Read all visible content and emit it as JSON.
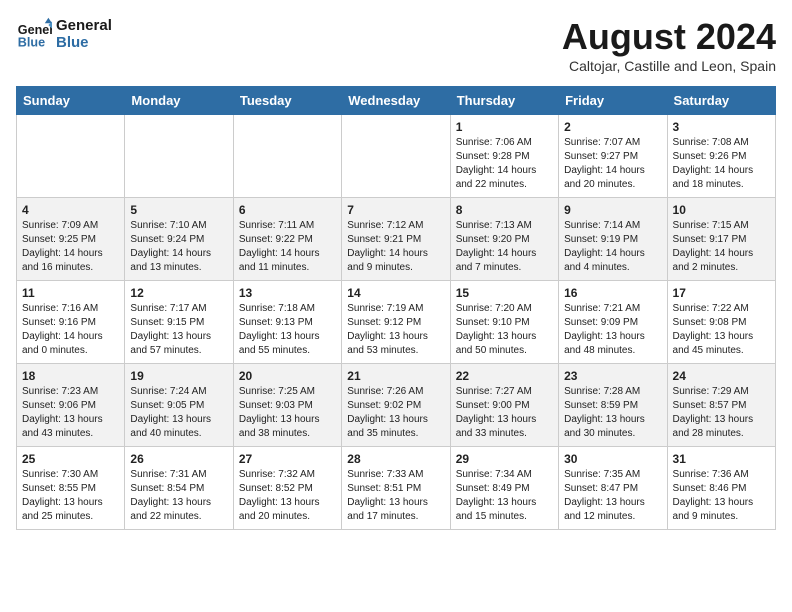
{
  "header": {
    "logo_line1": "General",
    "logo_line2": "Blue",
    "month_title": "August 2024",
    "subtitle": "Caltojar, Castille and Leon, Spain"
  },
  "days_of_week": [
    "Sunday",
    "Monday",
    "Tuesday",
    "Wednesday",
    "Thursday",
    "Friday",
    "Saturday"
  ],
  "weeks": [
    [
      {
        "day": "",
        "info": ""
      },
      {
        "day": "",
        "info": ""
      },
      {
        "day": "",
        "info": ""
      },
      {
        "day": "",
        "info": ""
      },
      {
        "day": "1",
        "info": "Sunrise: 7:06 AM\nSunset: 9:28 PM\nDaylight: 14 hours\nand 22 minutes."
      },
      {
        "day": "2",
        "info": "Sunrise: 7:07 AM\nSunset: 9:27 PM\nDaylight: 14 hours\nand 20 minutes."
      },
      {
        "day": "3",
        "info": "Sunrise: 7:08 AM\nSunset: 9:26 PM\nDaylight: 14 hours\nand 18 minutes."
      }
    ],
    [
      {
        "day": "4",
        "info": "Sunrise: 7:09 AM\nSunset: 9:25 PM\nDaylight: 14 hours\nand 16 minutes."
      },
      {
        "day": "5",
        "info": "Sunrise: 7:10 AM\nSunset: 9:24 PM\nDaylight: 14 hours\nand 13 minutes."
      },
      {
        "day": "6",
        "info": "Sunrise: 7:11 AM\nSunset: 9:22 PM\nDaylight: 14 hours\nand 11 minutes."
      },
      {
        "day": "7",
        "info": "Sunrise: 7:12 AM\nSunset: 9:21 PM\nDaylight: 14 hours\nand 9 minutes."
      },
      {
        "day": "8",
        "info": "Sunrise: 7:13 AM\nSunset: 9:20 PM\nDaylight: 14 hours\nand 7 minutes."
      },
      {
        "day": "9",
        "info": "Sunrise: 7:14 AM\nSunset: 9:19 PM\nDaylight: 14 hours\nand 4 minutes."
      },
      {
        "day": "10",
        "info": "Sunrise: 7:15 AM\nSunset: 9:17 PM\nDaylight: 14 hours\nand 2 minutes."
      }
    ],
    [
      {
        "day": "11",
        "info": "Sunrise: 7:16 AM\nSunset: 9:16 PM\nDaylight: 14 hours\nand 0 minutes."
      },
      {
        "day": "12",
        "info": "Sunrise: 7:17 AM\nSunset: 9:15 PM\nDaylight: 13 hours\nand 57 minutes."
      },
      {
        "day": "13",
        "info": "Sunrise: 7:18 AM\nSunset: 9:13 PM\nDaylight: 13 hours\nand 55 minutes."
      },
      {
        "day": "14",
        "info": "Sunrise: 7:19 AM\nSunset: 9:12 PM\nDaylight: 13 hours\nand 53 minutes."
      },
      {
        "day": "15",
        "info": "Sunrise: 7:20 AM\nSunset: 9:10 PM\nDaylight: 13 hours\nand 50 minutes."
      },
      {
        "day": "16",
        "info": "Sunrise: 7:21 AM\nSunset: 9:09 PM\nDaylight: 13 hours\nand 48 minutes."
      },
      {
        "day": "17",
        "info": "Sunrise: 7:22 AM\nSunset: 9:08 PM\nDaylight: 13 hours\nand 45 minutes."
      }
    ],
    [
      {
        "day": "18",
        "info": "Sunrise: 7:23 AM\nSunset: 9:06 PM\nDaylight: 13 hours\nand 43 minutes."
      },
      {
        "day": "19",
        "info": "Sunrise: 7:24 AM\nSunset: 9:05 PM\nDaylight: 13 hours\nand 40 minutes."
      },
      {
        "day": "20",
        "info": "Sunrise: 7:25 AM\nSunset: 9:03 PM\nDaylight: 13 hours\nand 38 minutes."
      },
      {
        "day": "21",
        "info": "Sunrise: 7:26 AM\nSunset: 9:02 PM\nDaylight: 13 hours\nand 35 minutes."
      },
      {
        "day": "22",
        "info": "Sunrise: 7:27 AM\nSunset: 9:00 PM\nDaylight: 13 hours\nand 33 minutes."
      },
      {
        "day": "23",
        "info": "Sunrise: 7:28 AM\nSunset: 8:59 PM\nDaylight: 13 hours\nand 30 minutes."
      },
      {
        "day": "24",
        "info": "Sunrise: 7:29 AM\nSunset: 8:57 PM\nDaylight: 13 hours\nand 28 minutes."
      }
    ],
    [
      {
        "day": "25",
        "info": "Sunrise: 7:30 AM\nSunset: 8:55 PM\nDaylight: 13 hours\nand 25 minutes."
      },
      {
        "day": "26",
        "info": "Sunrise: 7:31 AM\nSunset: 8:54 PM\nDaylight: 13 hours\nand 22 minutes."
      },
      {
        "day": "27",
        "info": "Sunrise: 7:32 AM\nSunset: 8:52 PM\nDaylight: 13 hours\nand 20 minutes."
      },
      {
        "day": "28",
        "info": "Sunrise: 7:33 AM\nSunset: 8:51 PM\nDaylight: 13 hours\nand 17 minutes."
      },
      {
        "day": "29",
        "info": "Sunrise: 7:34 AM\nSunset: 8:49 PM\nDaylight: 13 hours\nand 15 minutes."
      },
      {
        "day": "30",
        "info": "Sunrise: 7:35 AM\nSunset: 8:47 PM\nDaylight: 13 hours\nand 12 minutes."
      },
      {
        "day": "31",
        "info": "Sunrise: 7:36 AM\nSunset: 8:46 PM\nDaylight: 13 hours\nand 9 minutes."
      }
    ]
  ]
}
